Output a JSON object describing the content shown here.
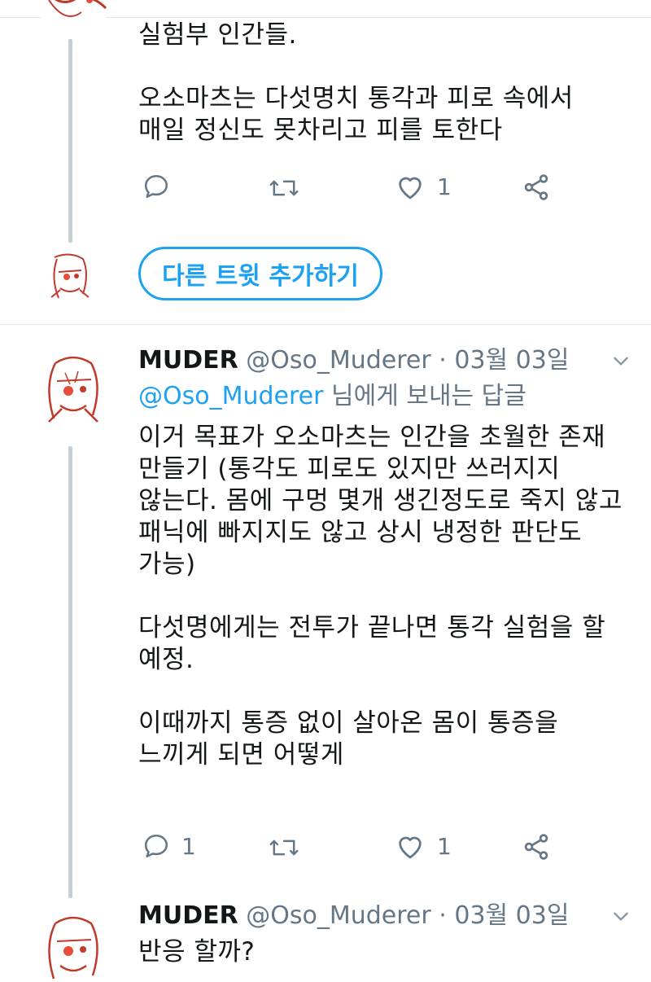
{
  "tweets": [
    {
      "text": "실험부 인간들.\n\n오소마츠는 다섯명치 통각과 피로 속에서\n매일 정신도 못차리고 피를 토한다",
      "actions": {
        "reply_count": "",
        "retweet_count": "",
        "like_count": "1"
      }
    },
    {
      "name": "MUDER",
      "handle": "@Oso_Muderer",
      "dot": "·",
      "date": "03월 03일",
      "reply_to_handle": "@Oso_Muderer",
      "reply_to_suffix": " 님에게 보내는 답글",
      "text": "이거 목표가 오소마츠는 인간을 초월한 존재\n만들기 (통각도 피로도 있지만 쓰러지지\n않는다. 몸에 구멍 몇개 생긴정도로 죽지 않고\n패닉에 빠지지도 않고 상시 냉정한 판단도\n가능)\n\n다섯명에게는 전투가 끝나면 통각 실험을 할\n예정.\n\n이때까지 통증 없이 살아온 몸이 통증을\n느끼게 되면 어떻게",
      "actions": {
        "reply_count": "1",
        "retweet_count": "",
        "like_count": "1"
      }
    },
    {
      "name": "MUDER",
      "handle": "@Oso_Muderer",
      "dot": "·",
      "date": "03월 03일",
      "text": "반응 할까?"
    }
  ],
  "add_tweet_button": "다른 트윗 추가하기",
  "icons": {
    "reply": "reply-icon",
    "retweet": "retweet-icon",
    "like": "heart-icon",
    "share": "share-icon",
    "more": "chevron-down-icon"
  },
  "colors": {
    "accent": "#1da1f2",
    "secondary_text": "#657786",
    "thread_line": "#c4cfd6"
  }
}
